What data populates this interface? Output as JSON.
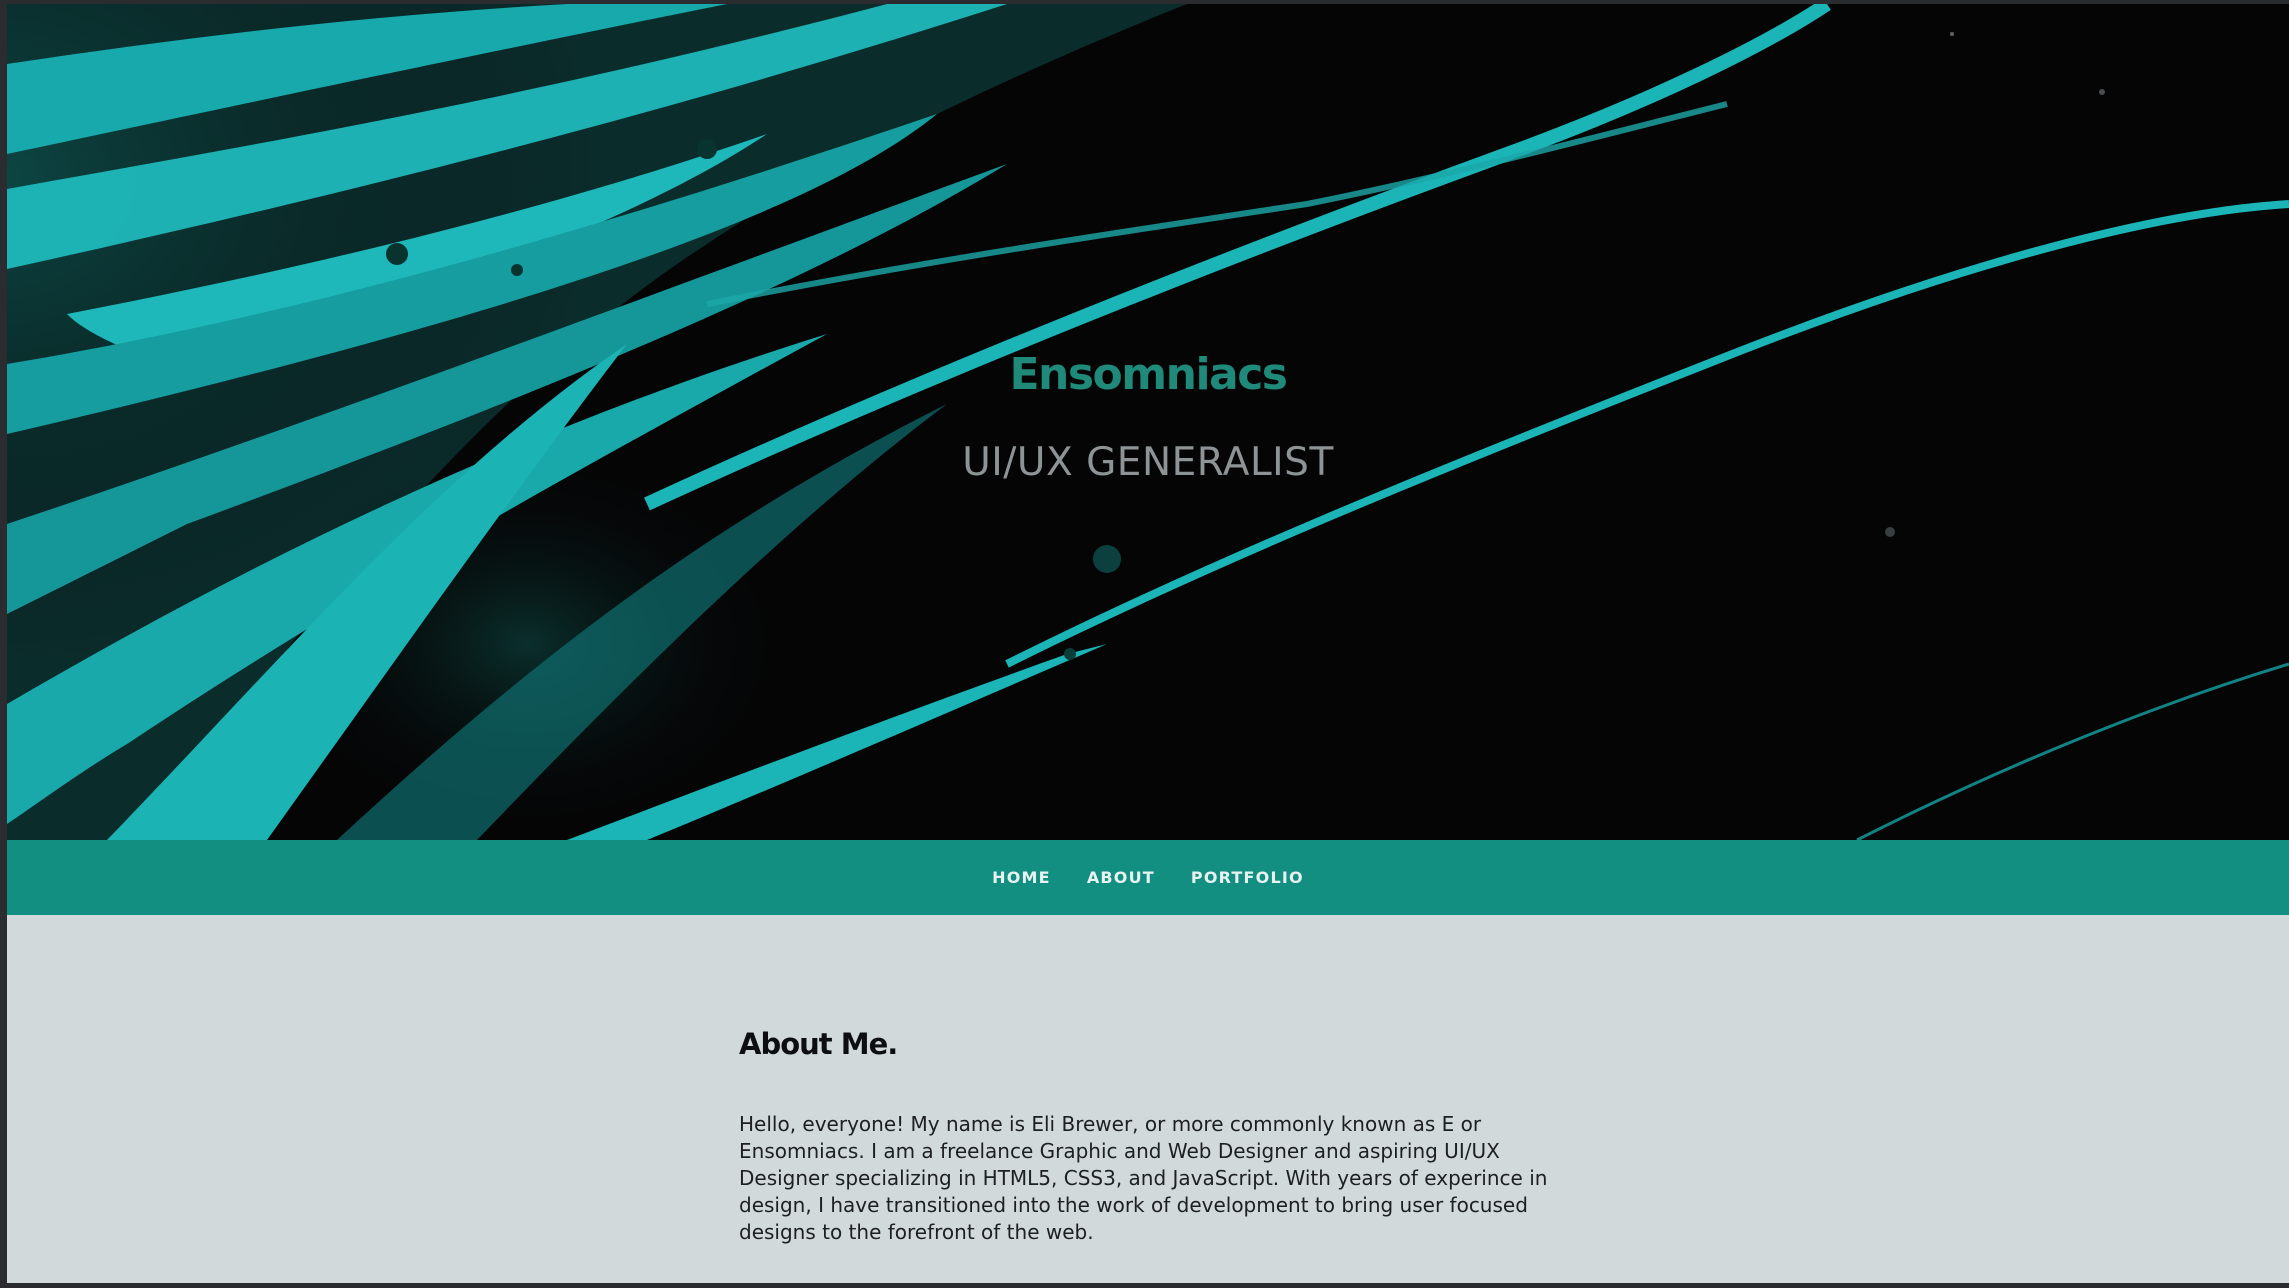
{
  "hero": {
    "title": "Ensomniacs",
    "subtitle": "UI/UX GENERALIST"
  },
  "nav": {
    "items": [
      {
        "label": "HOME"
      },
      {
        "label": "ABOUT"
      },
      {
        "label": "PORTFOLIO"
      }
    ]
  },
  "about": {
    "heading": "About Me.",
    "body": "Hello, everyone! My name is Eli Brewer, or more commonly known as E or Ensomniacs. I am a freelance Graphic and Web Designer and aspiring UI/UX Designer specializing in HTML5, CSS3, and JavaScript. With years of experince in design, I have transitioned into the work of development to bring user focused designs to the forefront of the web."
  },
  "colors": {
    "accent": "#138f82",
    "title": "#1f8a7a",
    "content_bg": "#d1d9da",
    "hero_bg": "#050506",
    "paint": "#19b3b6"
  }
}
